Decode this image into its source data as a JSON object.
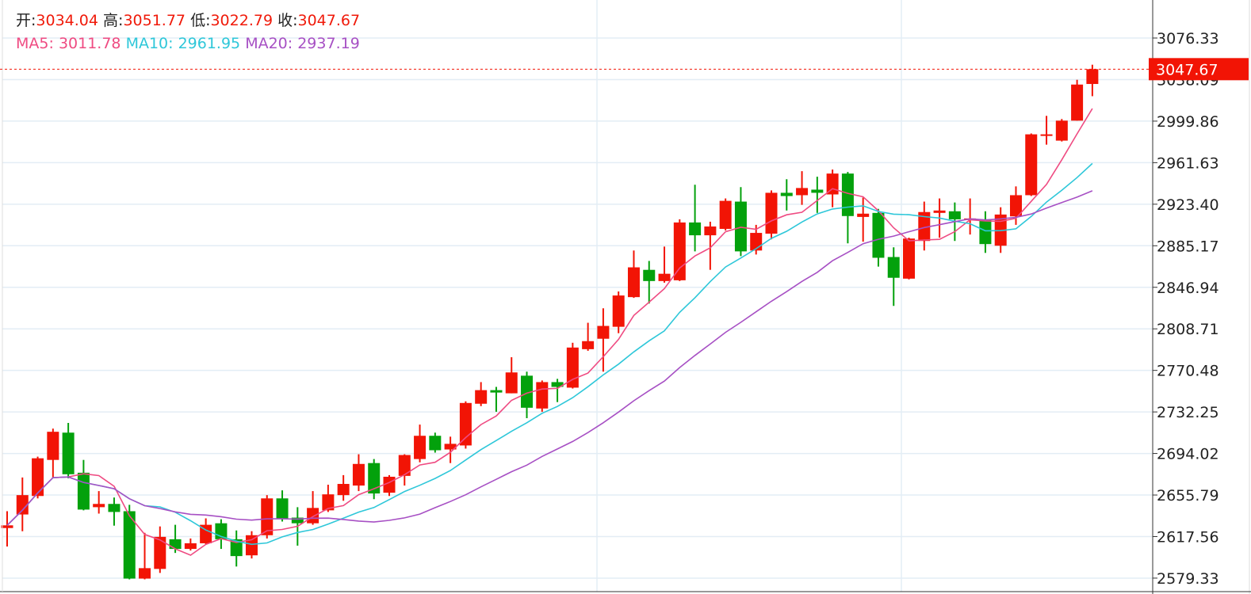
{
  "header": {
    "open_label": "开:",
    "open": "3034.04",
    "high_label": "高:",
    "high": "3051.77",
    "low_label": "低:",
    "low": "3022.79",
    "close_label": "收:",
    "close": "3047.67",
    "ma5_label": "MA5:",
    "ma5": "3011.78",
    "ma10_label": "MA10:",
    "ma10": "2961.95",
    "ma20_label": "MA20:",
    "ma20": "2937.19"
  },
  "colors": {
    "up": "#f21405",
    "down": "#03a10c",
    "ma5": "#ef4b82",
    "ma10": "#2ec7d9",
    "ma20": "#a750c4",
    "grid": "#e3edf5"
  },
  "chart_data": {
    "type": "candlestick",
    "title": "",
    "ylim": [
      2560,
      3090
    ],
    "y_ticks": [
      "3076.33",
      "3038.09",
      "2999.86",
      "2961.63",
      "2923.40",
      "2885.17",
      "2846.94",
      "2808.71",
      "2770.48",
      "2732.25",
      "2694.02",
      "2655.79",
      "2617.56",
      "2579.33"
    ],
    "last_price_label": "3047.67",
    "grid": true,
    "ohlc": [
      [
        2625.4,
        2640.9,
        2608.4,
        2627.9
      ],
      [
        2637.9,
        2671.9,
        2622.5,
        2655.7
      ],
      [
        2654.9,
        2691.1,
        2652.7,
        2689.6
      ],
      [
        2688.1,
        2716.9,
        2671.2,
        2714.0
      ],
      [
        2713.2,
        2722.1,
        2671.2,
        2674.9
      ],
      [
        2676.3,
        2688.1,
        2641.7,
        2642.4
      ],
      [
        2644.6,
        2659.4,
        2638.7,
        2647.6
      ],
      [
        2647.6,
        2653.5,
        2627.6,
        2640.2
      ],
      [
        2640.9,
        2646.8,
        2578.2,
        2578.9
      ],
      [
        2578.9,
        2621.0,
        2578.2,
        2588.5
      ],
      [
        2587.8,
        2626.9,
        2584.1,
        2617.3
      ],
      [
        2615.1,
        2628.4,
        2602.5,
        2606.2
      ],
      [
        2606.2,
        2615.8,
        2604.7,
        2611.4
      ],
      [
        2611.4,
        2634.3,
        2610.6,
        2628.4
      ],
      [
        2629.8,
        2633.5,
        2606.2,
        2615.1
      ],
      [
        2615.1,
        2623.2,
        2590.0,
        2599.6
      ],
      [
        2600.3,
        2622.5,
        2597.4,
        2618.8
      ],
      [
        2618.8,
        2655.7,
        2615.8,
        2652.7
      ],
      [
        2652.7,
        2660.1,
        2631.4,
        2634.3
      ],
      [
        2635.0,
        2644.6,
        2609.2,
        2629.8
      ],
      [
        2629.8,
        2659.4,
        2628.4,
        2643.9
      ],
      [
        2641.7,
        2665.3,
        2640.2,
        2656.4
      ],
      [
        2655.7,
        2674.1,
        2650.5,
        2666.0
      ],
      [
        2664.5,
        2693.3,
        2659.4,
        2684.4
      ],
      [
        2685.2,
        2688.9,
        2652.0,
        2657.2
      ],
      [
        2657.9,
        2674.1,
        2654.9,
        2672.6
      ],
      [
        2673.4,
        2693.3,
        2664.5,
        2692.6
      ],
      [
        2688.9,
        2720.6,
        2685.9,
        2710.3
      ],
      [
        2710.3,
        2713.2,
        2694.8,
        2697.0
      ],
      [
        2697.7,
        2709.5,
        2685.2,
        2702.9
      ],
      [
        2701.4,
        2742.0,
        2698.5,
        2740.5
      ],
      [
        2739.8,
        2759.7,
        2737.6,
        2752.3
      ],
      [
        2752.3,
        2755.3,
        2732.4,
        2750.1
      ],
      [
        2749.4,
        2782.6,
        2749.4,
        2768.6
      ],
      [
        2765.6,
        2769.3,
        2726.5,
        2736.1
      ],
      [
        2735.4,
        2761.2,
        2732.4,
        2759.7
      ],
      [
        2759.7,
        2762.7,
        2741.3,
        2755.3
      ],
      [
        2754.6,
        2795.9,
        2753.8,
        2791.5
      ],
      [
        2790.0,
        2814.3,
        2788.5,
        2797.4
      ],
      [
        2799.6,
        2827.6,
        2769.3,
        2811.4
      ],
      [
        2810.6,
        2843.1,
        2804.7,
        2839.4
      ],
      [
        2837.9,
        2880.8,
        2837.2,
        2865.3
      ],
      [
        2863.0,
        2871.2,
        2832.0,
        2852.7
      ],
      [
        2852.7,
        2884.4,
        2851.2,
        2859.4
      ],
      [
        2853.4,
        2909.5,
        2852.7,
        2906.6
      ],
      [
        2906.6,
        2941.3,
        2880.0,
        2894.8
      ],
      [
        2894.8,
        2907.3,
        2863.0,
        2902.9
      ],
      [
        2900.7,
        2928.7,
        2899.2,
        2926.5
      ],
      [
        2925.8,
        2939.1,
        2875.6,
        2880.0
      ],
      [
        2880.8,
        2904.4,
        2877.1,
        2897.0
      ],
      [
        2896.3,
        2936.1,
        2891.1,
        2933.9
      ],
      [
        2933.9,
        2946.4,
        2917.6,
        2930.9
      ],
      [
        2931.7,
        2953.8,
        2922.8,
        2938.3
      ],
      [
        2936.8,
        2948.7,
        2915.4,
        2933.9
      ],
      [
        2932.4,
        2955.3,
        2920.6,
        2951.6
      ],
      [
        2951.6,
        2953.1,
        2887.4,
        2912.5
      ],
      [
        2911.7,
        2929.5,
        2888.9,
        2914.7
      ],
      [
        2915.4,
        2919.1,
        2866.0,
        2874.1
      ],
      [
        2874.8,
        2883.7,
        2829.8,
        2855.7
      ],
      [
        2854.9,
        2892.6,
        2854.2,
        2891.8
      ],
      [
        2889.6,
        2925.8,
        2880.8,
        2916.2
      ],
      [
        2915.4,
        2928.7,
        2892.6,
        2917.6
      ],
      [
        2916.9,
        2925.0,
        2889.6,
        2909.5
      ],
      [
        2909.5,
        2928.7,
        2895.5,
        2910.3
      ],
      [
        2909.5,
        2916.9,
        2878.6,
        2886.7
      ],
      [
        2885.2,
        2920.6,
        2878.6,
        2913.9
      ],
      [
        2912.2,
        2939.8,
        2904.4,
        2931.7
      ],
      [
        2931.7,
        2988.5,
        2930.9,
        2987.7
      ],
      [
        2986.3,
        3004.7,
        2978.2,
        2987.7
      ],
      [
        2981.9,
        3001.8,
        2981.1,
        3000.3
      ],
      [
        3000.3,
        3037.9,
        3000.3,
        3033.5
      ],
      [
        3034.04,
        3051.77,
        3022.79,
        3047.67
      ]
    ],
    "series": [
      {
        "name": "MA5",
        "period": 5
      },
      {
        "name": "MA10",
        "period": 10
      },
      {
        "name": "MA20",
        "period": 20
      }
    ]
  }
}
